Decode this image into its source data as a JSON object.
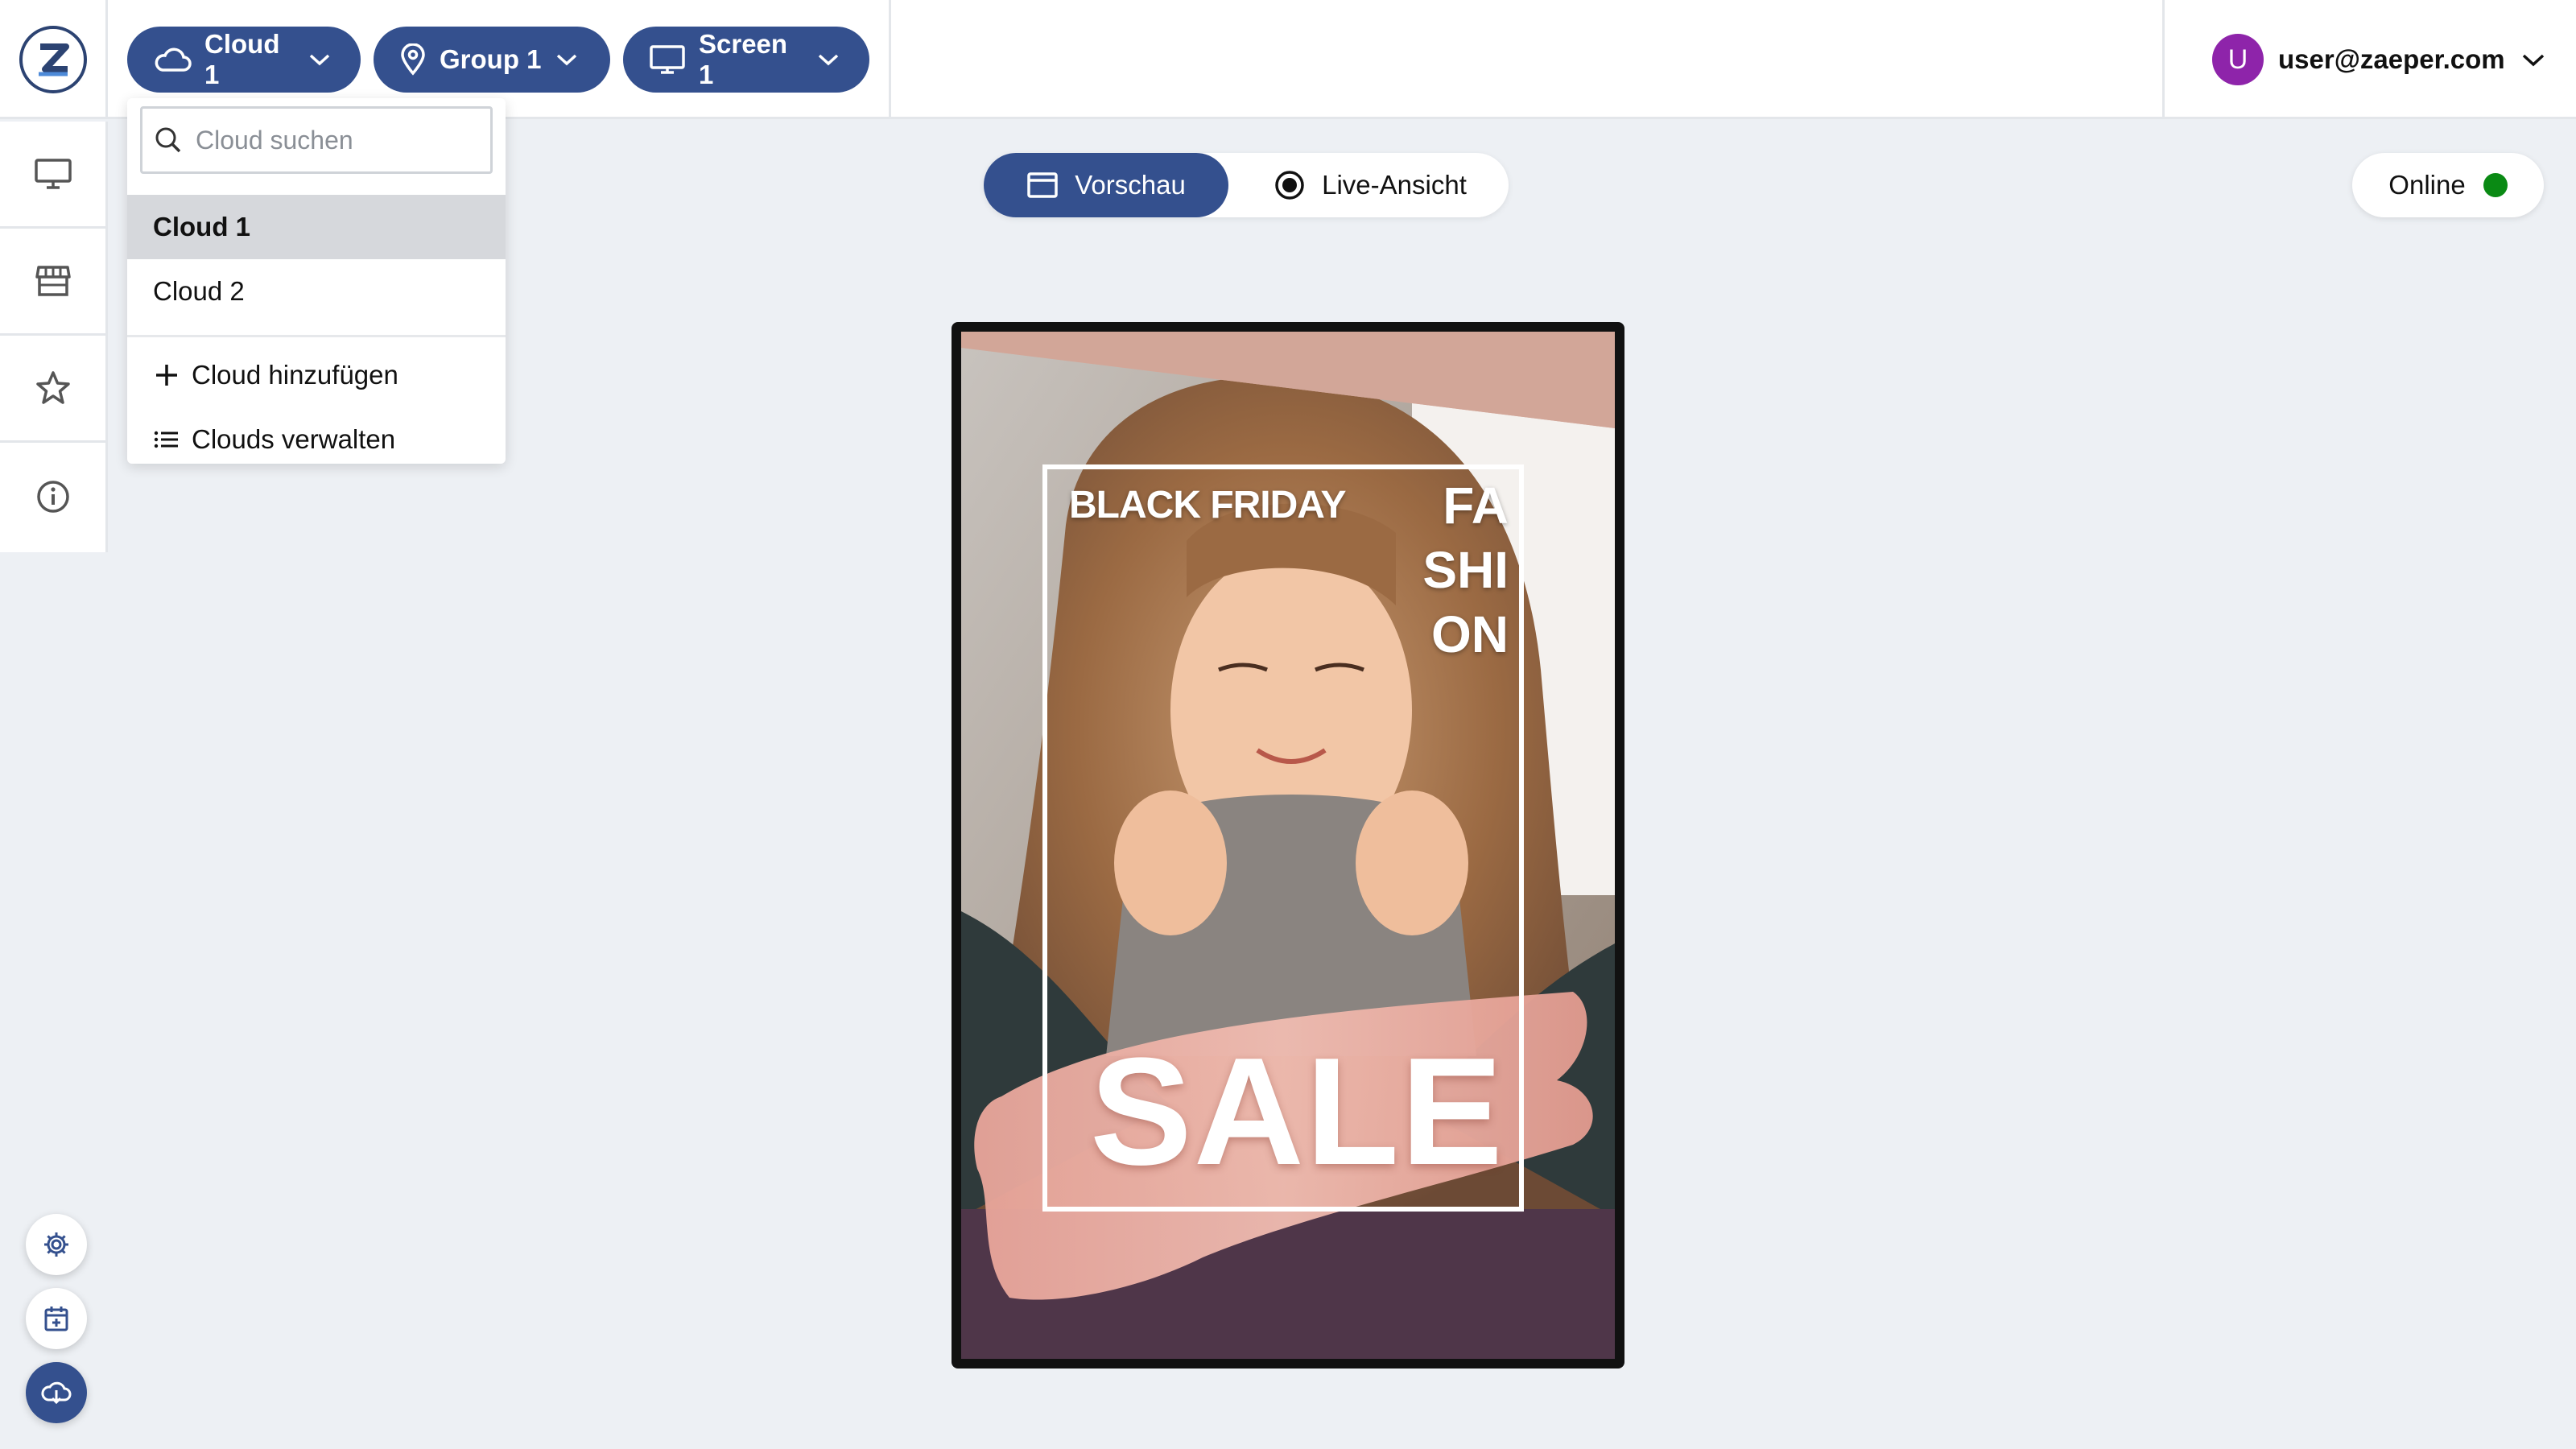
{
  "header": {
    "cloud_button": "Cloud 1",
    "group_button": "Group 1",
    "screen_button": "Screen 1",
    "user_initial": "U",
    "user_email": "user@zaeper.com"
  },
  "dropdown": {
    "search_placeholder": "Cloud suchen",
    "items": [
      "Cloud 1",
      "Cloud 2"
    ],
    "selected": "Cloud 1",
    "add_label": "Cloud hinzufügen",
    "manage_label": "Clouds verwalten"
  },
  "view_toggle": {
    "preview_label": "Vorschau",
    "live_label": "Live-Ansicht"
  },
  "status": {
    "label": "Online",
    "color": "#0a8a14"
  },
  "preview": {
    "headline": "BLACK FRIDAY",
    "fashion_lines": [
      "FA",
      "SHI",
      "ON"
    ],
    "sale": "SALE"
  },
  "colors": {
    "accent": "#34508e",
    "avatar": "#8e24aa"
  },
  "icons": {
    "sidebar": [
      "monitor-icon",
      "store-icon",
      "star-icon",
      "info-icon"
    ],
    "floating": [
      "settings-icon",
      "calendar-icon",
      "cloud-sync-icon"
    ]
  }
}
